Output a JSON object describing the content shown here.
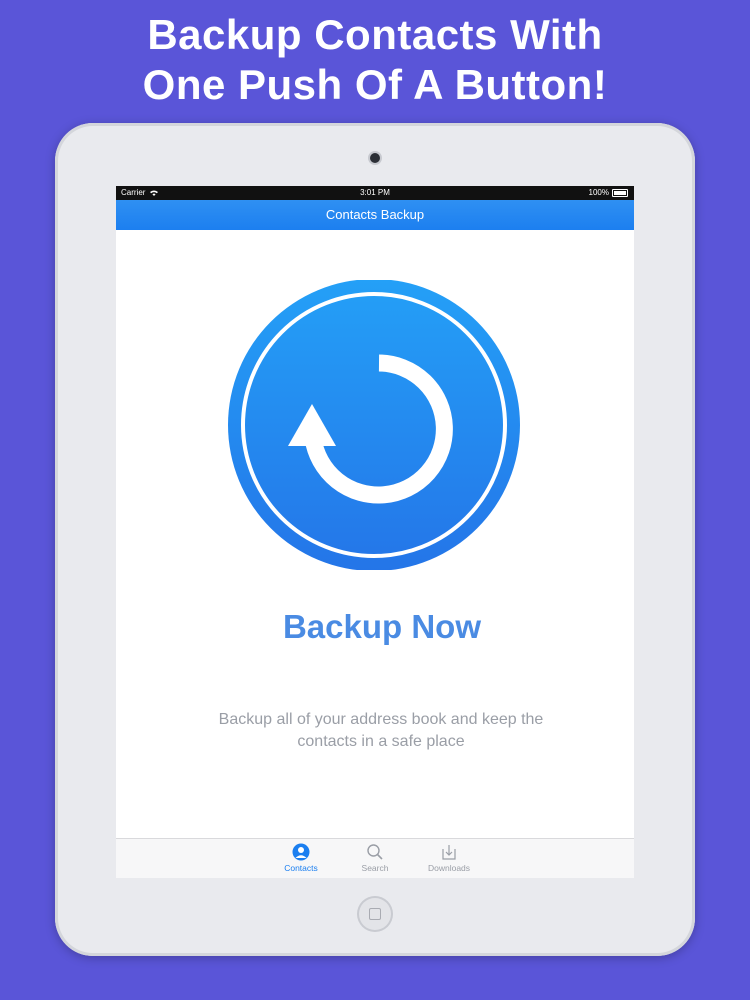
{
  "headline": {
    "line1": "Backup Contacts With",
    "line2": "One Push Of A Button!"
  },
  "status_bar": {
    "carrier": "Carrier",
    "time": "3:01 PM",
    "battery": "100%"
  },
  "nav_bar": {
    "title": "Contacts Backup"
  },
  "main": {
    "button_label": "Backup Now",
    "description_line1": "Backup all of your address book and keep the",
    "description_line2": "contacts in a safe place"
  },
  "tab_bar": {
    "items": [
      {
        "label": "Contacts",
        "icon": "contacts-icon",
        "active": true
      },
      {
        "label": "Search",
        "icon": "search-icon",
        "active": false
      },
      {
        "label": "Downloads",
        "icon": "downloads-icon",
        "active": false
      }
    ]
  },
  "colors": {
    "background": "#5a55d8",
    "accent": "#1b7ff0",
    "title_blue": "#4a8be3"
  }
}
